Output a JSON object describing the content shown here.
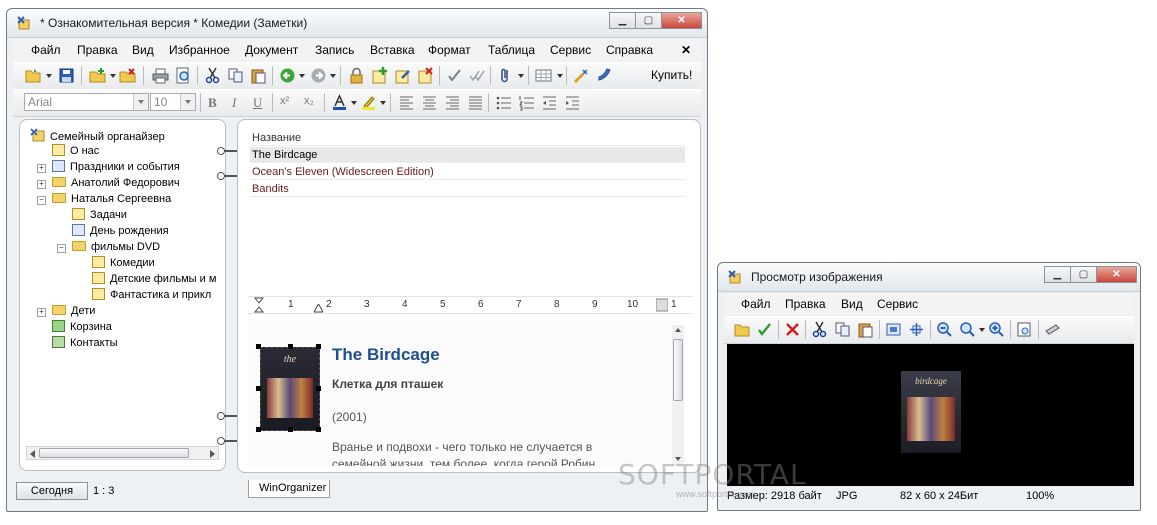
{
  "main_window": {
    "title": "* Ознакомительная версия * Комедии (Заметки)",
    "menu": [
      "Файл",
      "Правка",
      "Вид",
      "Избранное",
      "Документ",
      "Запись",
      "Вставка",
      "Формат",
      "Таблица",
      "Сервис",
      "Справка"
    ],
    "menu_close": "✕",
    "buy_label": "Купить!",
    "font_name": "Arial",
    "font_size": "10",
    "tree": {
      "root": "Семейный органайзер",
      "items": [
        "О нас",
        "Праздники и события",
        "Анатолий Федорович",
        "Наталья Сергеевна",
        "Задачи",
        "День рождения",
        "фильмы DVD",
        "Комедии",
        "Детские фильмы и м",
        "Фантастика и прикл",
        "Дети",
        "Корзина",
        "Контакты"
      ]
    },
    "list": {
      "header": "Название",
      "rows": [
        "The Birdcage",
        "Ocean's Eleven (Widescreen Edition)",
        "Bandits"
      ]
    },
    "ruler": [
      "1",
      "2",
      "3",
      "4",
      "5",
      "6",
      "7",
      "8",
      "9",
      "10",
      "1"
    ],
    "doc": {
      "title": "The Birdcage",
      "subtitle": "Клетка для пташек",
      "year": "(2001)",
      "body_line1": "Вранье и подвохи - чего только не случается в",
      "body_line2": "семейной жизни, тем более, когда герой Робин"
    },
    "doc_tab": "WinOrganizer",
    "today_button": "Сегодня",
    "status_ratio": "1 : 3",
    "colors": {
      "accent_title": "#1f4e8c",
      "selected_row": "#e8e8e8",
      "list_link": "#6b1a1a"
    }
  },
  "viewer_window": {
    "title": "Просмотр изображения",
    "menu": [
      "Файл",
      "Правка",
      "Вид",
      "Сервис"
    ],
    "status": {
      "size": "Размер: 2918 байт",
      "format": "JPG",
      "dims": "82 x 60 x 24Бит",
      "zoom": "100%"
    }
  },
  "watermark": {
    "brand": "SOFTPORTAL",
    "url": "www.softportal.com"
  }
}
